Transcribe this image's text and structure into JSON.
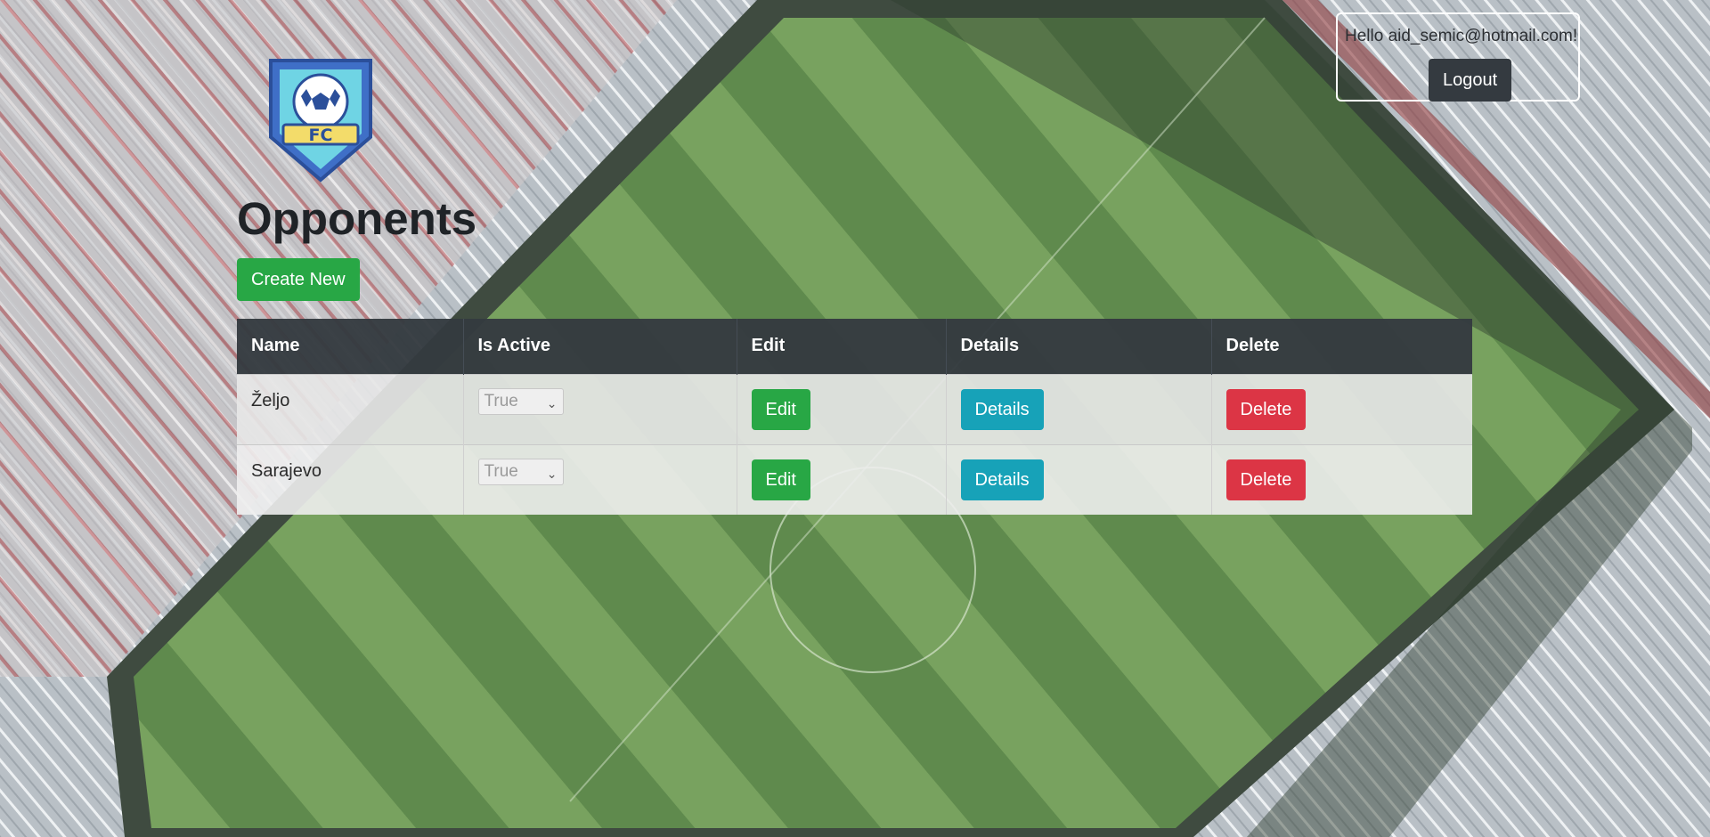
{
  "app": {
    "logo_text": "FC"
  },
  "account": {
    "greeting": "Hello aid_semic@hotmail.com!",
    "logout_label": "Logout"
  },
  "page": {
    "title": "Opponents",
    "create_label": "Create New"
  },
  "table": {
    "headers": [
      "Name",
      "Is Active",
      "Edit",
      "Details",
      "Delete"
    ],
    "rows": [
      {
        "name": "Željo",
        "is_active": "True",
        "edit": "Edit",
        "details": "Details",
        "delete": "Delete"
      },
      {
        "name": "Sarajevo",
        "is_active": "True",
        "edit": "Edit",
        "details": "Details",
        "delete": "Delete"
      }
    ]
  },
  "colors": {
    "success": "#28a745",
    "info": "#17a2b8",
    "danger": "#dc3545",
    "dark": "#343a40"
  },
  "icons": {
    "logo": "football-shield-icon",
    "select_arrow": "chevron-down-icon"
  }
}
